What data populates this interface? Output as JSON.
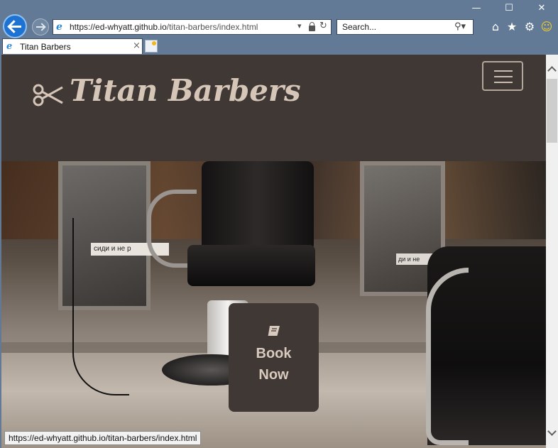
{
  "window": {
    "minimize_glyph": "—",
    "maximize_glyph": "☐",
    "close_glyph": "✕"
  },
  "toolbar": {
    "address_host": "https://ed-whyatt.github.io",
    "address_path": "/titan-barbers/index.html",
    "search_placeholder": "Search...",
    "icons": [
      "back-icon",
      "forward-icon",
      "lock-icon",
      "refresh-icon",
      "search-icon",
      "home-icon",
      "favorites-star-icon",
      "settings-gear-icon",
      "feedback-smiley-icon"
    ]
  },
  "tabs": [
    {
      "label": "Titan Barbers",
      "close_glyph": "×"
    }
  ],
  "site": {
    "brand": "Titan Barbers",
    "accent_color": "#d6c6b7",
    "header_bg": "#403835",
    "book_button_label": "Book\nNow",
    "hero_sign_1": "сиди и не р",
    "hero_sign_2": "ди и не"
  },
  "status_bar": {
    "url": "https://ed-whyatt.github.io/titan-barbers/index.html"
  }
}
